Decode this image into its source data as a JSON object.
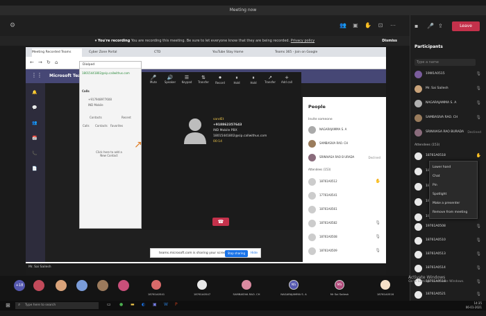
{
  "window": {
    "title": "Meeting now"
  },
  "recording_banner": {
    "bold": "You're recording",
    "text": "You are recording this meeting. Be sure to let everyone know that they are being recorded.",
    "link": "Privacy policy",
    "dismiss": "Dismiss"
  },
  "meeting_controls": {
    "leave": "Leave"
  },
  "participants_panel": {
    "title": "Participants",
    "search_placeholder": "Type a name",
    "presenters": [
      "19W1A0515",
      "Mr. Sai Sailesh",
      "NAGARAJAMMA S. A",
      "SAMBASIVA RAO. CH",
      "SRINIVASA RAO BURADA"
    ],
    "presenter_status": "Declined",
    "attendees_header": "Attendees (153)",
    "attendees": [
      "18761A0518",
      "18761A0521",
      "18761A0529",
      "18761A0542",
      "19761A0501",
      "19761A0508",
      "18761A0510",
      "18761A0513",
      "18761A0514",
      "18761A0516",
      "18761A0521"
    ],
    "context_menu": [
      "Lower hand",
      "Chat",
      "Pin",
      "Spotlight",
      "Make a presenter",
      "Remove from meeting"
    ]
  },
  "browser": {
    "tabs": [
      "Meeting Recorded Teams",
      "Cyber Zone Portal",
      "CTD",
      "YouTube Stay Home",
      "Teams 365 - Join on Google"
    ],
    "app_name": "Microsoft Teams"
  },
  "dialer": {
    "header": "Dialpad",
    "number": "18015441802@sip.callwithus.com",
    "calls_label": "Calls",
    "contact_name": "+917948977608",
    "contact_sub": "IND Mobile",
    "tab_contacts": "Contacts",
    "tab_recent": "Recent",
    "sub_tabs": [
      "Calls",
      "Contacts",
      "Favorites"
    ],
    "empty_text": "Click here to add a New Contact"
  },
  "call_window": {
    "controls": [
      "Mute",
      "Speaker",
      "Keypad",
      "Transfer",
      "Record",
      "Hold",
      "Hold",
      "Transfer",
      "Add call"
    ],
    "caller": "+918862357643",
    "caller_id": "sandEt",
    "caller_location": "IND Mobile PBX",
    "caller_sip": "18015441802@sip.callwithus.com",
    "duration": "00:14"
  },
  "people_panel": {
    "title": "People",
    "invite_placeholder": "Invite someone",
    "presenters": [
      "NAGARAJAMMA S. A",
      "SAMBASIVA RAO. CH",
      "SRINIVASA RAO B URADA"
    ],
    "presenter_status": "Declined",
    "attendees_header": "Attendees (153)",
    "attendees": [
      "18761A0512",
      "17761A0541",
      "18761A0561",
      "18761A0582",
      "18761A0508",
      "18761A0509",
      "18761A0584"
    ]
  },
  "share_bar": {
    "text": "teams.microsoft.com is sharing your screen.",
    "stop": "Stop sharing",
    "hide": "Hide"
  },
  "bottom_strip": {
    "tiles": [
      "18761A0541",
      "18761A0547",
      "18761A0541",
      "SAMBASIVA RAO. CH",
      "NAGARAJAMMA S. A",
      "Mr Sai Sailesh",
      "18761A0516"
    ],
    "extra_count": "+18",
    "self_name": "Mr. Sai Sailesh"
  },
  "activate_windows": {
    "title": "Activate Windows",
    "sub": "Go to Settings to activate Windows."
  },
  "taskbar": {
    "search_placeholder": "Type here to search",
    "time": "14:35",
    "date": "06-01-2021"
  }
}
